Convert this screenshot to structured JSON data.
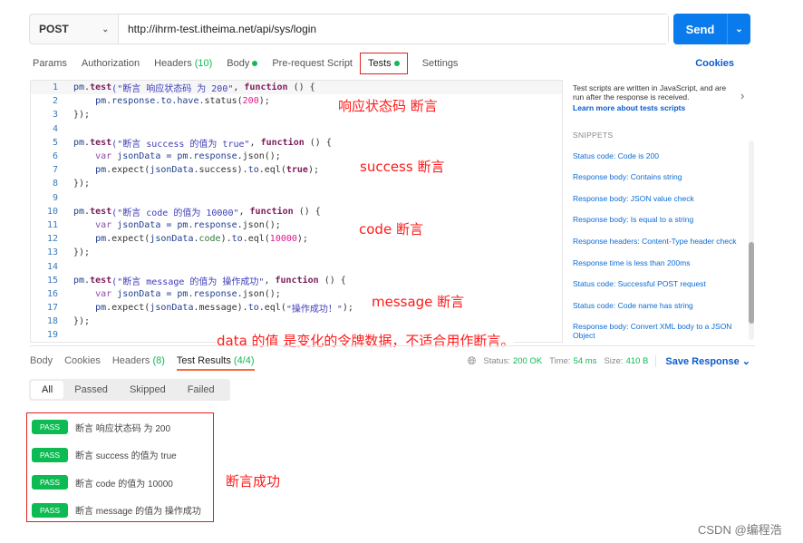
{
  "request": {
    "method": "POST",
    "url": "http://ihrm-test.itheima.net/api/sys/login",
    "send_label": "Send"
  },
  "req_tabs": [
    {
      "label": "Params"
    },
    {
      "label": "Authorization"
    },
    {
      "label": "Headers",
      "count": "(10)"
    },
    {
      "label": "Body",
      "dot": true
    },
    {
      "label": "Pre-request Script"
    },
    {
      "label": "Tests",
      "dot": true,
      "active": true
    },
    {
      "label": "Settings"
    }
  ],
  "cookies_label": "Cookies",
  "code_lines": [
    [
      [
        "pm",
        "pm"
      ],
      [
        ".",
        "o"
      ],
      [
        "test",
        "b"
      ],
      [
        "(\"断言 响应状态码 为 200\"",
        "s"
      ],
      [
        ", ",
        "o"
      ],
      [
        "function",
        "b"
      ],
      [
        " () {",
        "o"
      ]
    ],
    [
      [
        "    pm",
        "pm"
      ],
      [
        ".response.to.have.",
        "pm"
      ],
      [
        "status(",
        "o"
      ],
      [
        "200",
        "n"
      ],
      [
        ");",
        "o"
      ]
    ],
    [
      [
        "});",
        "o"
      ]
    ],
    [],
    [
      [
        "pm",
        "pm"
      ],
      [
        ".",
        "o"
      ],
      [
        "test",
        "b"
      ],
      [
        "(\"断言 success 的值为 true\"",
        "s"
      ],
      [
        ", ",
        "o"
      ],
      [
        "function",
        "b"
      ],
      [
        " () {",
        "o"
      ]
    ],
    [
      [
        "    var",
        "v"
      ],
      [
        " jsonData = ",
        "pm"
      ],
      [
        "pm.response",
        "pm"
      ],
      [
        ".json();",
        "o"
      ]
    ],
    [
      [
        "    pm",
        "pm"
      ],
      [
        ".expect(",
        "o"
      ],
      [
        "jsonData",
        "pm"
      ],
      [
        ".success).",
        "o"
      ],
      [
        "to",
        "pm"
      ],
      [
        ".eql(",
        "o"
      ],
      [
        "true",
        "b"
      ],
      [
        ");",
        "o"
      ]
    ],
    [
      [
        "});",
        "o"
      ]
    ],
    [],
    [
      [
        "pm",
        "pm"
      ],
      [
        ".",
        "o"
      ],
      [
        "test",
        "b"
      ],
      [
        "(\"断言 code 的值为 10000\"",
        "s"
      ],
      [
        ", ",
        "o"
      ],
      [
        "function",
        "b"
      ],
      [
        " () {",
        "o"
      ]
    ],
    [
      [
        "    var",
        "v"
      ],
      [
        " jsonData = ",
        "pm"
      ],
      [
        "pm.response",
        "pm"
      ],
      [
        ".json();",
        "o"
      ]
    ],
    [
      [
        "    pm",
        "pm"
      ],
      [
        ".expect(",
        "o"
      ],
      [
        "jsonData",
        "pm"
      ],
      [
        ".",
        "o"
      ],
      [
        "code",
        "g"
      ],
      [
        ").",
        "o"
      ],
      [
        "to",
        "pm"
      ],
      [
        ".eql(",
        "o"
      ],
      [
        "10000",
        "n"
      ],
      [
        ");",
        "o"
      ]
    ],
    [
      [
        "});",
        "o"
      ]
    ],
    [],
    [
      [
        "pm",
        "pm"
      ],
      [
        ".",
        "o"
      ],
      [
        "test",
        "b"
      ],
      [
        "(\"断言 message 的值为 操作成功\"",
        "s"
      ],
      [
        ", ",
        "o"
      ],
      [
        "function",
        "b"
      ],
      [
        " () {",
        "o"
      ]
    ],
    [
      [
        "    var",
        "v"
      ],
      [
        " jsonData = ",
        "pm"
      ],
      [
        "pm.response",
        "pm"
      ],
      [
        ".json();",
        "o"
      ]
    ],
    [
      [
        "    pm",
        "pm"
      ],
      [
        ".expect(",
        "o"
      ],
      [
        "jsonData",
        "pm"
      ],
      [
        ".message).",
        "o"
      ],
      [
        "to",
        "pm"
      ],
      [
        ".eql(",
        "o"
      ],
      [
        "\"操作成功！\"",
        "s"
      ],
      [
        ");",
        "o"
      ]
    ],
    [
      [
        "});",
        "o"
      ]
    ],
    []
  ],
  "annotations": {
    "status": "响应状态码 断言",
    "success": "success 断言",
    "code": "code 断言",
    "message": "message 断言",
    "data": "data 的值 是变化的令牌数据，不适合用作断言。",
    "result": "断言成功"
  },
  "side": {
    "info": "Test scripts are written in JavaScript, and are run after the response is received.",
    "learn": "Learn more about tests scripts",
    "snippets_title": "SNIPPETS",
    "snippets": [
      "Status code: Code is 200",
      "Response body: Contains string",
      "Response body: JSON value check",
      "Response body: Is equal to a string",
      "Response headers: Content-Type header check",
      "Response time is less than 200ms",
      "Status code: Successful POST request",
      "Status code: Code name has string",
      "Response body: Convert XML body to a JSON Object"
    ]
  },
  "response": {
    "tabs": [
      "Body",
      "Cookies",
      "Headers",
      "Test Results"
    ],
    "headers_count": "(8)",
    "tests_count": "(4/4)",
    "status_label": "Status:",
    "status": "200 OK",
    "time_label": "Time:",
    "time": "54 ms",
    "size_label": "Size:",
    "size": "410 B",
    "save_label": "Save Response"
  },
  "filters": [
    "All",
    "Passed",
    "Skipped",
    "Failed"
  ],
  "results": [
    {
      "badge": "PASS",
      "name": "断言 响应状态码 为 200"
    },
    {
      "badge": "PASS",
      "name": "断言 success 的值为 true"
    },
    {
      "badge": "PASS",
      "name": "断言 code 的值为 10000"
    },
    {
      "badge": "PASS",
      "name": "断言 message 的值为 操作成功"
    }
  ],
  "watermark": "CSDN @编程浩"
}
